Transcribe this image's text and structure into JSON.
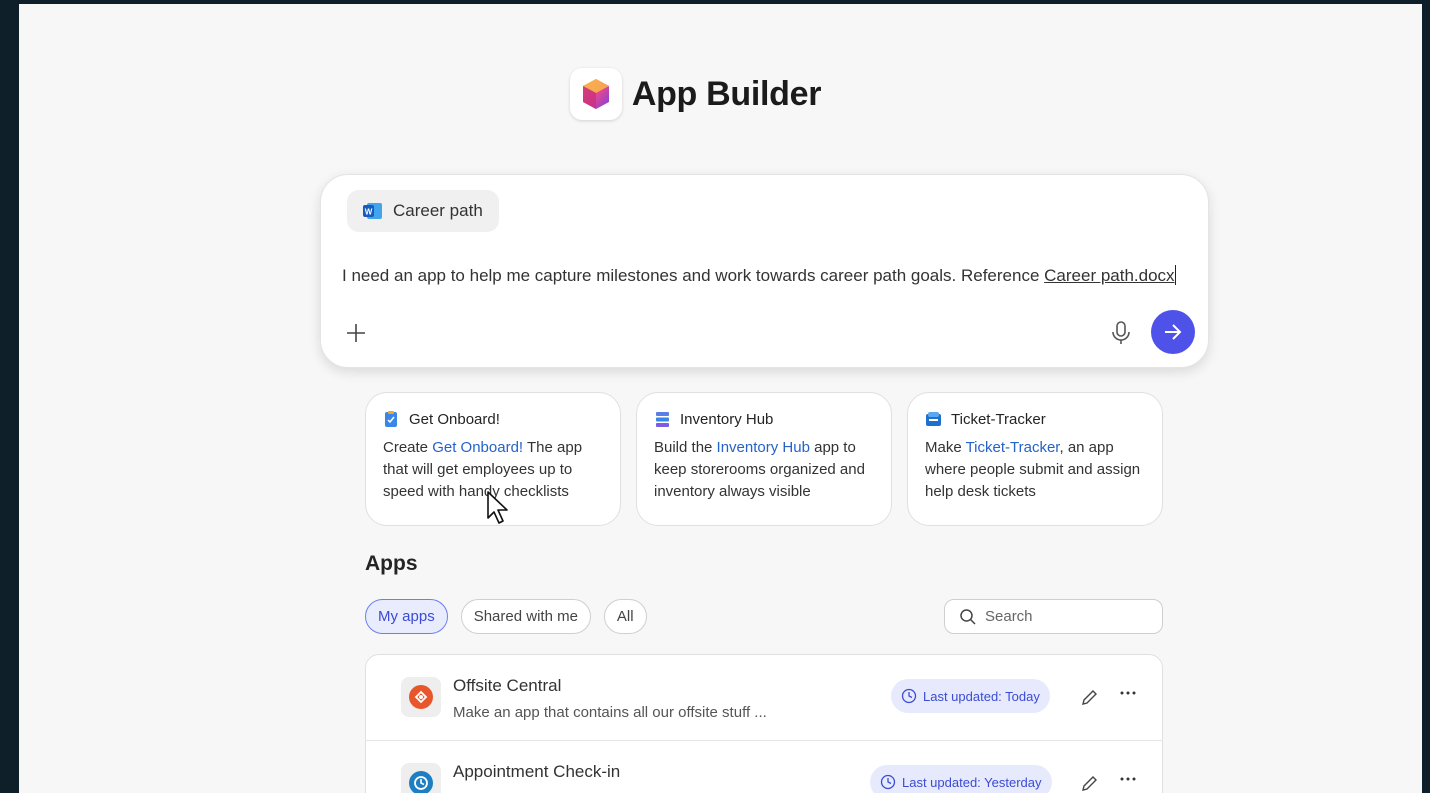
{
  "app": {
    "title": "App Builder"
  },
  "prompt": {
    "file_chip_label": "Career path",
    "text": "I need an app to help me capture milestones and work towards career path goals. Reference ",
    "reference": "Career path.docx",
    "icons": {
      "attach": "plus-icon",
      "mic": "microphone-icon",
      "send": "arrow-right-icon"
    },
    "accent": "#4f52e8"
  },
  "suggestions": [
    {
      "title": "Get Onboard!",
      "pre": "Create ",
      "link": "Get Onboard!",
      "post": " The app that will get employees up to speed with handy checklists"
    },
    {
      "title": "Inventory Hub",
      "pre": "Build the ",
      "link": "Inventory Hub",
      "post": " app to keep storerooms organized and inventory always visible"
    },
    {
      "title": "Ticket-Tracker",
      "pre": "Make ",
      "link": "Ticket-Tracker",
      "post": ", an app where people submit and assign help desk tickets"
    }
  ],
  "apps": {
    "heading": "Apps",
    "filters": [
      "My apps",
      "Shared with me",
      "All"
    ],
    "active_filter": "My apps",
    "search_placeholder": "Search",
    "rows": [
      {
        "name": "Offsite Central",
        "description": "Make an app that contains all our offsite stuff ...",
        "updated": "Last updated: Today",
        "icon_color": "#e8572c"
      },
      {
        "name": "Appointment Check-in",
        "description": "",
        "updated": "Last updated: Yesterday",
        "icon_color": "#1d7fc2"
      }
    ]
  }
}
